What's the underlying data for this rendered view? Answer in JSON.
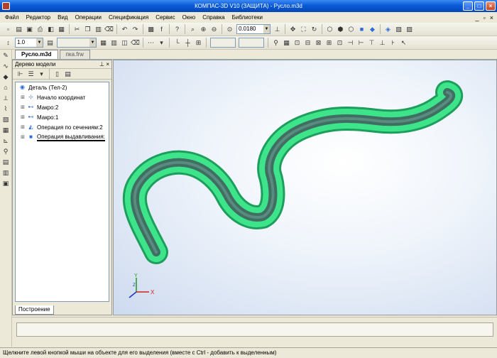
{
  "window": {
    "title": "КОМПАС-3D V10 (ЗАЩИТА) - Русло.m3d"
  },
  "menu": {
    "items": [
      "Файл",
      "Редактор",
      "Вид",
      "Операции",
      "Спецификация",
      "Сервис",
      "Окно",
      "Справка",
      "Библиотеки"
    ]
  },
  "toolbar": {
    "zoom_value": "0.0180",
    "step_value": "1.0"
  },
  "tabs": [
    {
      "label": "Русло.m3d",
      "active": true
    },
    {
      "label": "пка.frw",
      "active": false
    }
  ],
  "tree": {
    "title": "Дерево модели",
    "root": "Деталь (Тел-2)",
    "items": [
      {
        "label": "Начало координат",
        "icon": "axes-icon"
      },
      {
        "label": "Макро:2",
        "icon": "macro-icon"
      },
      {
        "label": "Макро:1",
        "icon": "macro-icon"
      },
      {
        "label": "Операция по сечениям:2",
        "icon": "loft-icon"
      },
      {
        "label": "Операция выдавливания:",
        "icon": "extrude-icon"
      }
    ],
    "bottom_tab": "Построение"
  },
  "axes": {
    "x": "X",
    "y": "Y",
    "z": "Z"
  },
  "colors": {
    "model_green": "#3ee48a",
    "model_dark": "#3f6f63",
    "viewport_bg": "#dbe6f5",
    "titlebar": "#0a5bd6"
  },
  "status": {
    "text": "Щелкните левой кнопкой мыши на объекте для его выделения (вместе с Ctrl - добавить к выделенным)"
  }
}
